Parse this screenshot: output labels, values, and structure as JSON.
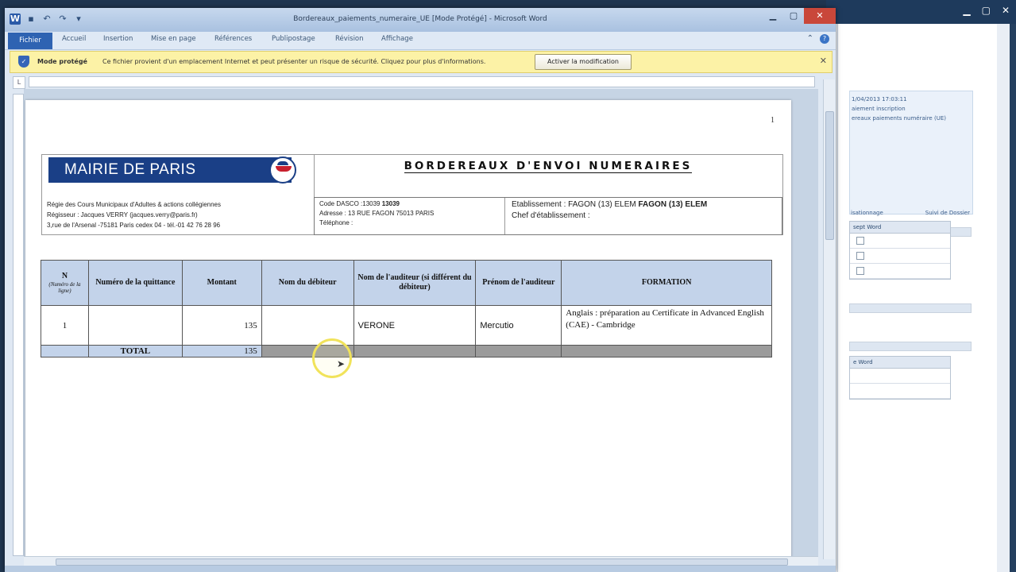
{
  "window": {
    "title": "Bordereaux_paiements_numeraire_UE [Mode Protégé] - Microsoft Word",
    "tabs": [
      "Fichier",
      "Accueil",
      "Insertion",
      "Mise en page",
      "Références",
      "Publipostage",
      "Révision",
      "Affichage"
    ]
  },
  "protected_bar": {
    "title": "Mode protégé",
    "message": "Ce fichier provient d'un emplacement Internet et peut présenter un risque de sécurité. Cliquez pour plus d'informations.",
    "button": "Activer la modification"
  },
  "document": {
    "page_number": "1",
    "logo_text": "MAIRIE DE PARIS",
    "title": "BORDEREAUX D'ENVOI NUMERAIRES",
    "regie_lines": [
      "Régie des Cours Municipaux d'Adultes & actions collégiennes",
      "Régisseur : Jacques VERRY (jacques.verry@paris.fr)",
      "3,rue de l'Arsenal -75181 Paris cedex 04 - tél.-01 42 76 28 96"
    ],
    "code_dasco_label": "Code DASCO :13039",
    "code_dasco_value": "13039",
    "address": "Adresse : 13 RUE FAGON 75013 PARIS",
    "telephone": "Téléphone :",
    "etablissement_label": "Etablissement : FAGON (13) ELEM",
    "etablissement_value": "FAGON (13) ELEM",
    "chef": "Chef d'établissement :"
  },
  "table": {
    "headers": {
      "n": "N",
      "n_sub": "(Numéro de la ligne)",
      "quittance": "Numéro de la quittance",
      "montant": "Montant",
      "debiteur": "Nom du débiteur",
      "auditeur": "Nom de l'auditeur (si différent du débiteur)",
      "prenom": "Prénom de l'auditeur",
      "formation": "FORMATION"
    },
    "row": {
      "n": "1",
      "quittance": "",
      "montant": "135",
      "debiteur": "",
      "auditeur": "VERONE",
      "prenom": "Mercutio",
      "formation": "Anglais : préparation au Certificate in Advanced English (CAE) - Cambridge"
    },
    "total_label": "TOTAL",
    "total_value": "135"
  },
  "bg_window": {
    "lines": [
      "1/04/2013 17:03:11",
      "aiement inscription",
      "ereaux paiements numéraire (UE)"
    ],
    "links": [
      "isationnage",
      "Suivi de Dossier"
    ],
    "table1_header": "sept Word",
    "table2_header": "e Word"
  }
}
